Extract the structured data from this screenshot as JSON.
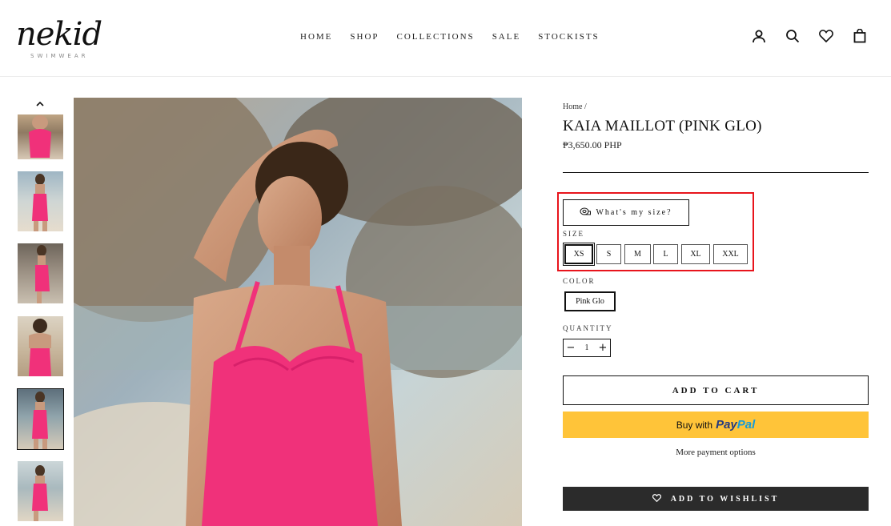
{
  "brand": {
    "logo_text": "nekid",
    "logo_sub": "SWIMWEAR"
  },
  "nav": {
    "items": [
      "HOME",
      "SHOP",
      "COLLECTIONS",
      "SALE",
      "STOCKISTS"
    ]
  },
  "header_icons": [
    "account-icon",
    "search-icon",
    "heart-icon",
    "cart-icon"
  ],
  "breadcrumb": "Home /",
  "product": {
    "title": "KAIA MAILLOT (PINK GLO)",
    "price": "₱3,650.00 PHP"
  },
  "size_guide": {
    "label": "What's my size?",
    "icon": "tape-measure-icon"
  },
  "size": {
    "label": "SIZE",
    "options": [
      "XS",
      "S",
      "M",
      "L",
      "XL",
      "XXL"
    ],
    "selected": "XS"
  },
  "color": {
    "label": "COLOR",
    "options": [
      "Pink Glo"
    ],
    "selected": "Pink Glo"
  },
  "quantity": {
    "label": "QUANTITY",
    "value": "1",
    "minus": "−",
    "plus": "+"
  },
  "buttons": {
    "add_to_cart": "ADD TO CART",
    "paypal_prefix": "Buy with",
    "paypal_brand_1": "Pay",
    "paypal_brand_2": "Pal",
    "more_payment": "More payment options",
    "add_to_wishlist": "ADD TO WISHLIST"
  },
  "colors": {
    "accent_pink": "#f0317a",
    "paypal_yellow": "#ffc439",
    "highlight_red": "#e8141c",
    "dark_button": "#2b2b2b"
  }
}
